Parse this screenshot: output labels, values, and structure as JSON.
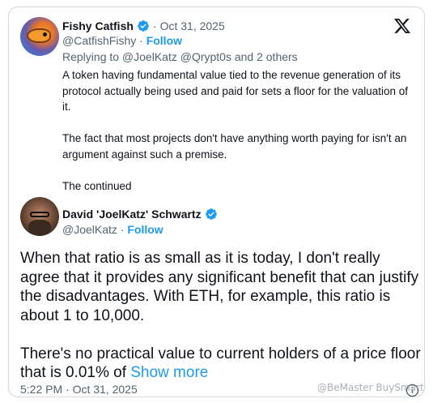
{
  "brand_color": "#1d9bf0",
  "icons": {
    "logo": "x-logo-icon",
    "verified": "verified-badge-icon",
    "info": "info-icon"
  },
  "quoted": {
    "name": "Fishy Catfish",
    "date": "Oct 31, 2025",
    "separator": "·",
    "handle": "@CatfishFishy",
    "follow_label": "Follow",
    "reply_context": "Replying to @JoelKatz @Qrypt0s and 2 others",
    "paragraphs": [
      "A token having fundamental value tied to the revenue generation of its protocol actually being used and paid for sets a floor for the valuation of it.",
      "The fact that most projects don't have anything worth paying for isn't an argument against such a premise.",
      "The continued"
    ]
  },
  "main": {
    "name": "David 'JoelKatz' Schwartz",
    "handle": "@JoelKatz",
    "separator": "·",
    "follow_label": "Follow",
    "paragraphs": [
      "When that ratio is as small as it is today, I don't really agree that it provides any significant benefit that can justify the disadvantages. With ETH, for example, this ratio is about 1 to 10,000.",
      "There's no practical value to current holders of a price floor that is 0.01% of "
    ],
    "show_more_label": "Show more",
    "timestamp": "5:22 PM · Oct 31, 2025"
  },
  "watermark": "@BeMaster BuySmart"
}
